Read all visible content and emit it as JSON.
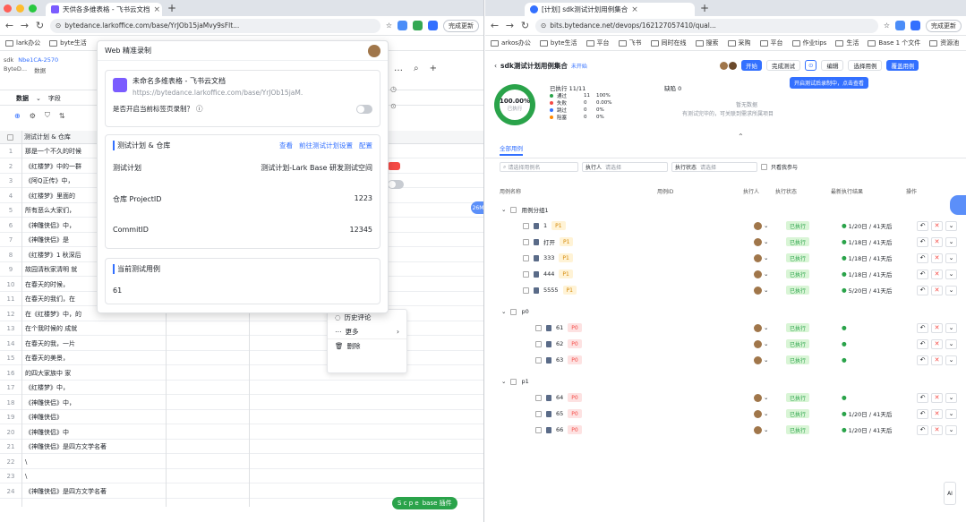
{
  "left": {
    "tab_title": "天供各多维表格 - 飞书云文档",
    "url": "bytedance.larkoffice.com/base/YrJOb15jaMvy9sFlt...",
    "update_btn": "完成更新",
    "bookmarks": [
      "lark办公",
      "byte生活"
    ],
    "app_bar": [
      "sdk",
      "Nbe1CA-2570",
      "ByteD...",
      "数据",
      "字段",
      "工具"
    ],
    "panel": {
      "header": "Web 精准录制",
      "doc_title": "未命名多维表格 - 飞书云文档",
      "doc_url": "https://bytedance.larkoffice.com/base/YrJOb15jaM.",
      "enable_q": "是否开启当前标签页录制？",
      "plan_title": "测试计划 & 仓库",
      "plan_links": [
        "查看",
        "前往测试计划设置",
        "配置"
      ],
      "fields": [
        {
          "k": "测试计划",
          "v": "测试计划-Lark Base 研发测试空间"
        },
        {
          "k": "仓库 ProjectID",
          "v": "1223"
        },
        {
          "k": "CommitID",
          "v": "12345"
        }
      ],
      "case_title": "当前测试用例",
      "case_value": "61"
    },
    "menu": [
      "历史评论",
      "更多",
      "删除"
    ],
    "rows": [
      "那是一个不久的时候",
      "《红楼梦》中的一群",
      "《阿Q正传》中，",
      "《红楼梦》里面的",
      "所有恶么大家们，",
      "《神雕侠侣》中，",
      "《神雕侠侣》是",
      "《红楼梦》1 秋深后",
      "故园清秋家清明 就",
      "在春天的时候，",
      "在春天的我们，在",
      "在《红楼梦》中，的",
      "在个我时候的 成就",
      "在春天的我，一片",
      "在春天的美景，",
      "的四大家族中 家",
      "《红楼梦》中，",
      "《神雕侠侣》中，",
      "《神雕侠侣》",
      "《神雕侠侣》中",
      "《神雕侠侣》是四方文学名著",
      "\\",
      "\\",
      "《神雕侠侣》是四方文学名著"
    ],
    "float_pill": [
      "S c p e",
      "base 插件"
    ]
  },
  "right": {
    "tab_title": "[计划] sdk测试计划用例集合",
    "url": "bits.bytedance.net/devops/162127057410/qual...",
    "update_btn": "完成更新",
    "bookmarks": [
      "arkos办公",
      "byte生活",
      "平台",
      "飞书",
      "同时在线",
      "搜索",
      "采购",
      "平台",
      "作业tips",
      "生活",
      "Base 1 个文件",
      "资源池"
    ],
    "title": "sdk测试计划用例集合",
    "title_tag": "未开始",
    "buttons": [
      "开始",
      "完成测试",
      "编辑",
      "选择用例",
      "覆盖用例"
    ],
    "record_btn": "开启测试后录制中，点击查看",
    "progress": {
      "pct": "100.00%",
      "label": "已执行",
      "summary": "已执行 11/11",
      "bug": "缺陷 0"
    },
    "status": [
      {
        "k": "通过",
        "n": "11",
        "p": "100%"
      },
      {
        "k": "失败",
        "n": "0",
        "p": "0.00%"
      },
      {
        "k": "跳过",
        "n": "0",
        "p": "0%"
      },
      {
        "k": "阻塞",
        "n": "0",
        "p": "0%"
      }
    ],
    "empty_text": "暂无数据",
    "hint": "有测试完毕的，可关联到需求所属项目",
    "case_link": "全部用例",
    "filters": [
      "请选择用例名",
      "执行人",
      "请选择",
      "执行状态",
      "请选择",
      "只看我参与"
    ],
    "columns": [
      "用例名称",
      "用例ID",
      "执行人",
      "执行状态",
      "最新执行结果",
      "操作"
    ],
    "groups": [
      {
        "name": "用例分组1",
        "rows": [
          {
            "id": "1",
            "res": "1/20日 / 41天后"
          },
          {
            "id": "打开",
            "res": "1/18日 / 41天后"
          },
          {
            "id": "333",
            "res": "1/18日 / 41天后"
          },
          {
            "id": "444",
            "res": "1/18日 / 41天后"
          },
          {
            "id": "5555",
            "res": "5/20日 / 41天后"
          }
        ]
      },
      {
        "name": "p0",
        "rows": [
          {
            "id": "61",
            "res": ""
          },
          {
            "id": "62",
            "res": ""
          },
          {
            "id": "63",
            "res": ""
          }
        ]
      },
      {
        "name": "p1",
        "rows": [
          {
            "id": "64",
            "res": ""
          },
          {
            "id": "65",
            "res": "1/20日 / 41天后"
          },
          {
            "id": "66",
            "res": "1/20日 / 41天后"
          }
        ]
      }
    ],
    "exec_tag": "已执行"
  }
}
